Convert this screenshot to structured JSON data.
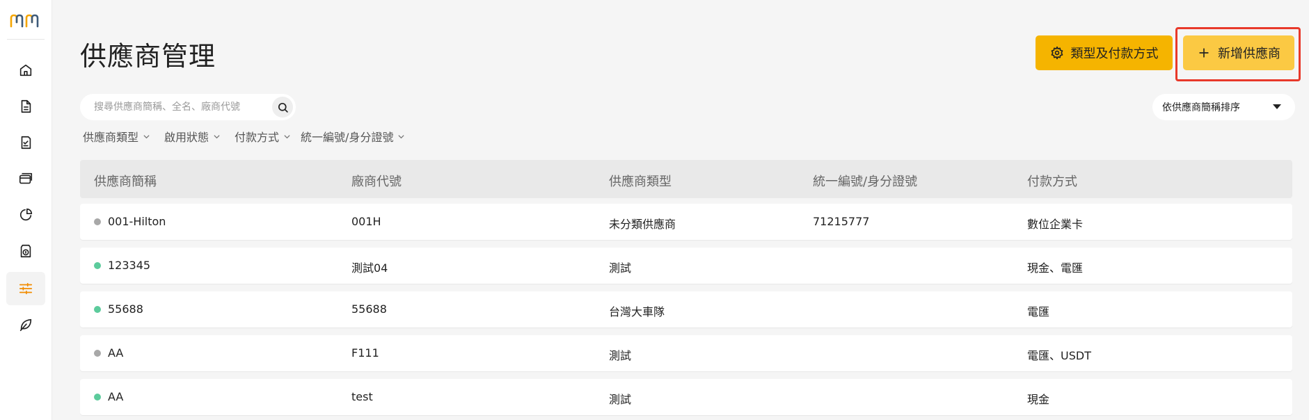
{
  "page": {
    "title": "供應商管理",
    "types_button": "類型及付款方式",
    "add_button": "新增供應商",
    "search_placeholder": "搜尋供應商簡稱、全名、廠商代號",
    "sort_label": "依供應商簡稱排序"
  },
  "filters": [
    "供應商類型",
    "啟用狀態",
    "付款方式",
    "統一編號/身分證號"
  ],
  "table": {
    "headers": [
      "供應商簡稱",
      "廠商代號",
      "供應商類型",
      "統一編號/身分證號",
      "付款方式"
    ],
    "rows": [
      {
        "status": "inactive",
        "name": "001-Hilton",
        "code": "001H",
        "type": "未分類供應商",
        "tax_id": "71215777",
        "payment": "數位企業卡"
      },
      {
        "status": "active",
        "name": "123345",
        "code": "測試04",
        "type": "測試",
        "tax_id": "",
        "payment": "現金、電匯"
      },
      {
        "status": "active",
        "name": "55688",
        "code": "55688",
        "type": "台灣大車隊",
        "tax_id": "",
        "payment": "電匯"
      },
      {
        "status": "inactive",
        "name": "AA",
        "code": "F111",
        "type": "測試",
        "tax_id": "",
        "payment": "電匯、USDT"
      },
      {
        "status": "active",
        "name": "AA",
        "code": "test",
        "type": "測試",
        "tax_id": "",
        "payment": "現金"
      }
    ]
  },
  "colors": {
    "accent": "#f5b400",
    "accent_light": "#fbc943",
    "active_dot": "#5ccb9c",
    "inactive_dot": "#a8a8a8",
    "highlight": "#e8392a"
  },
  "nav": [
    "home-icon",
    "document-icon",
    "checklist-icon",
    "credit-card-icon",
    "pie-chart-icon",
    "money-icon",
    "sliders-icon",
    "leaf-icon"
  ]
}
